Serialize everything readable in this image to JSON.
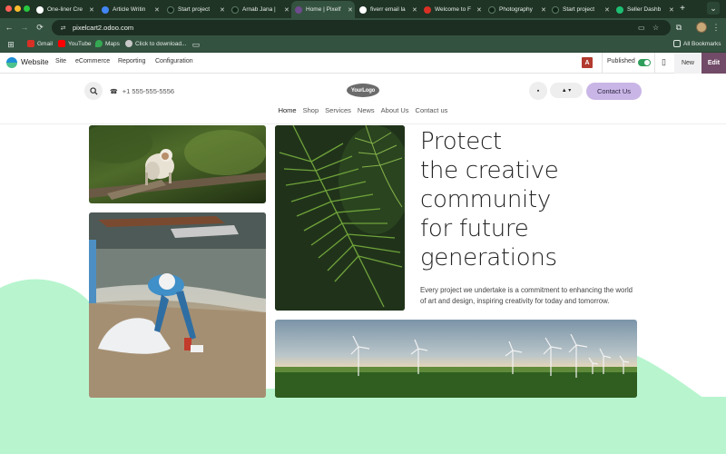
{
  "browser": {
    "tabs": [
      {
        "title": "One-liner Cre",
        "color": "#ffffff",
        "active": false
      },
      {
        "title": "Article Writin",
        "color": "#4285f4",
        "active": false
      },
      {
        "title": "Start project",
        "color": "#1f3425",
        "active": false
      },
      {
        "title": "Arnab Jana |",
        "color": "#1f3425",
        "active": false
      },
      {
        "title": "Home | Pixelf",
        "color": "#6d4b8c",
        "active": true
      },
      {
        "title": "fiverr email la",
        "color": "#ffffff",
        "active": false
      },
      {
        "title": "Welcome to F",
        "color": "#d93025",
        "active": false
      },
      {
        "title": "Photography",
        "color": "#1f3425",
        "active": false
      },
      {
        "title": "Start project",
        "color": "#1f3425",
        "active": false
      },
      {
        "title": "Seller Dashb",
        "color": "#1dbf73",
        "active": false
      }
    ],
    "url": "pixelcart2.odoo.com",
    "bookmarks": [
      {
        "label": "Gmail",
        "color": "#d93025"
      },
      {
        "label": "YouTube",
        "color": "#ff0000"
      },
      {
        "label": "Maps",
        "color": "#34a853"
      },
      {
        "label": "Click to download...",
        "color": "#c9c9c9"
      }
    ],
    "all_bookmarks": "All Bookmarks",
    "icons": {
      "new_tab": "+",
      "tab_list": "⌄",
      "back": "←",
      "forward": "→",
      "reload": "⟳",
      "site_info": "⇄",
      "cast": "▭",
      "star": "☆",
      "extensions": "⧉",
      "menu": "⋮",
      "apps": "⊞",
      "folder": "▭"
    }
  },
  "odoo_bar": {
    "brand": "Website",
    "menu": [
      "Site",
      "eCommerce",
      "Reporting",
      "Configuration"
    ],
    "badge": "A",
    "published": "Published",
    "published_state": true,
    "device_icon": "▯",
    "new_label": "New",
    "edit_label": "Edit"
  },
  "site": {
    "search_icon": "magnifier",
    "phone_icon": "☎",
    "phone": "+1 555-555-5556",
    "logo": "YourLogo",
    "cart_icon": "▪",
    "user_icon": "▲ ▾",
    "contact_button": "Contact Us",
    "nav": [
      {
        "label": "Home",
        "active": true
      },
      {
        "label": "Shop",
        "active": false
      },
      {
        "label": "Services",
        "active": false
      },
      {
        "label": "News",
        "active": false
      },
      {
        "label": "About Us",
        "active": false
      },
      {
        "label": "Contact us",
        "active": false
      }
    ]
  },
  "hero": {
    "headline_lines": [
      "Protect",
      "the creative",
      "community",
      "for future",
      "generations"
    ],
    "lead": "Every project we undertake is a commitment to enhancing the world of art and design, inspiring creativity for today and tomorrow.",
    "accent_color": "#b8f5cf"
  }
}
